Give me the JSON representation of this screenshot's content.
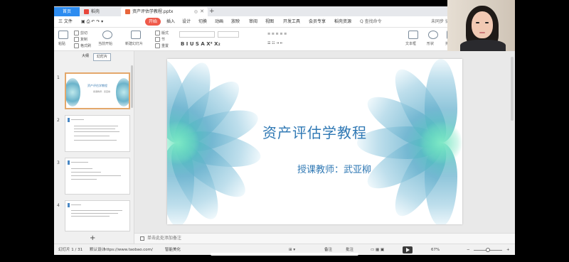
{
  "tabs": {
    "home": "首页",
    "wps": "稻壳",
    "doc": "资产评估学教程.pptx"
  },
  "menu": {
    "file": "三 文件",
    "items": [
      "开始",
      "插入",
      "设计",
      "切换",
      "动画",
      "放映",
      "审阅",
      "视图",
      "开发工具",
      "会员专享",
      "稻壳资源"
    ],
    "search": "Q 查找命令",
    "share": "未同步  协作  分享"
  },
  "ribbon": {
    "paste": "粘贴",
    "cut": "剪切",
    "copy": "复制",
    "format_painter": "格式刷",
    "from_current": "当前开始",
    "new_slide": "新建幻灯片",
    "layout": "版式",
    "section": "节",
    "reset": "重置",
    "font_sample": "",
    "textbox": "文本框",
    "shapes": "形状",
    "arrange": "排列",
    "format_row": "B  I  U  S  A  X²  X₂"
  },
  "left_panel": {
    "tab_outline": "大纲",
    "tab_slides": "幻灯片",
    "thumb_numbers": [
      "1",
      "2",
      "3",
      "4"
    ],
    "thumb1_title": "资产评估学教程",
    "thumb1_sub": "授课教师：武亚柳",
    "add": "+"
  },
  "slide": {
    "title": "资产评估学教程",
    "subtitle": "授课教师：武亚柳"
  },
  "notes": {
    "placeholder": "单击此处添加备注"
  },
  "status": {
    "slide_counter": "幻灯片 1 / 31",
    "theme": "默认设计",
    "url": "https://www.taobao.com/",
    "smart": "智能美化",
    "notes_btn": "备注",
    "comments_btn": "批注",
    "zoom": "67%",
    "zoom_level": 0.5
  },
  "colors": {
    "accent_tab": "#2d8cf0",
    "start_menu": "#ef5a4a",
    "slide_text": "#2f78b4"
  }
}
